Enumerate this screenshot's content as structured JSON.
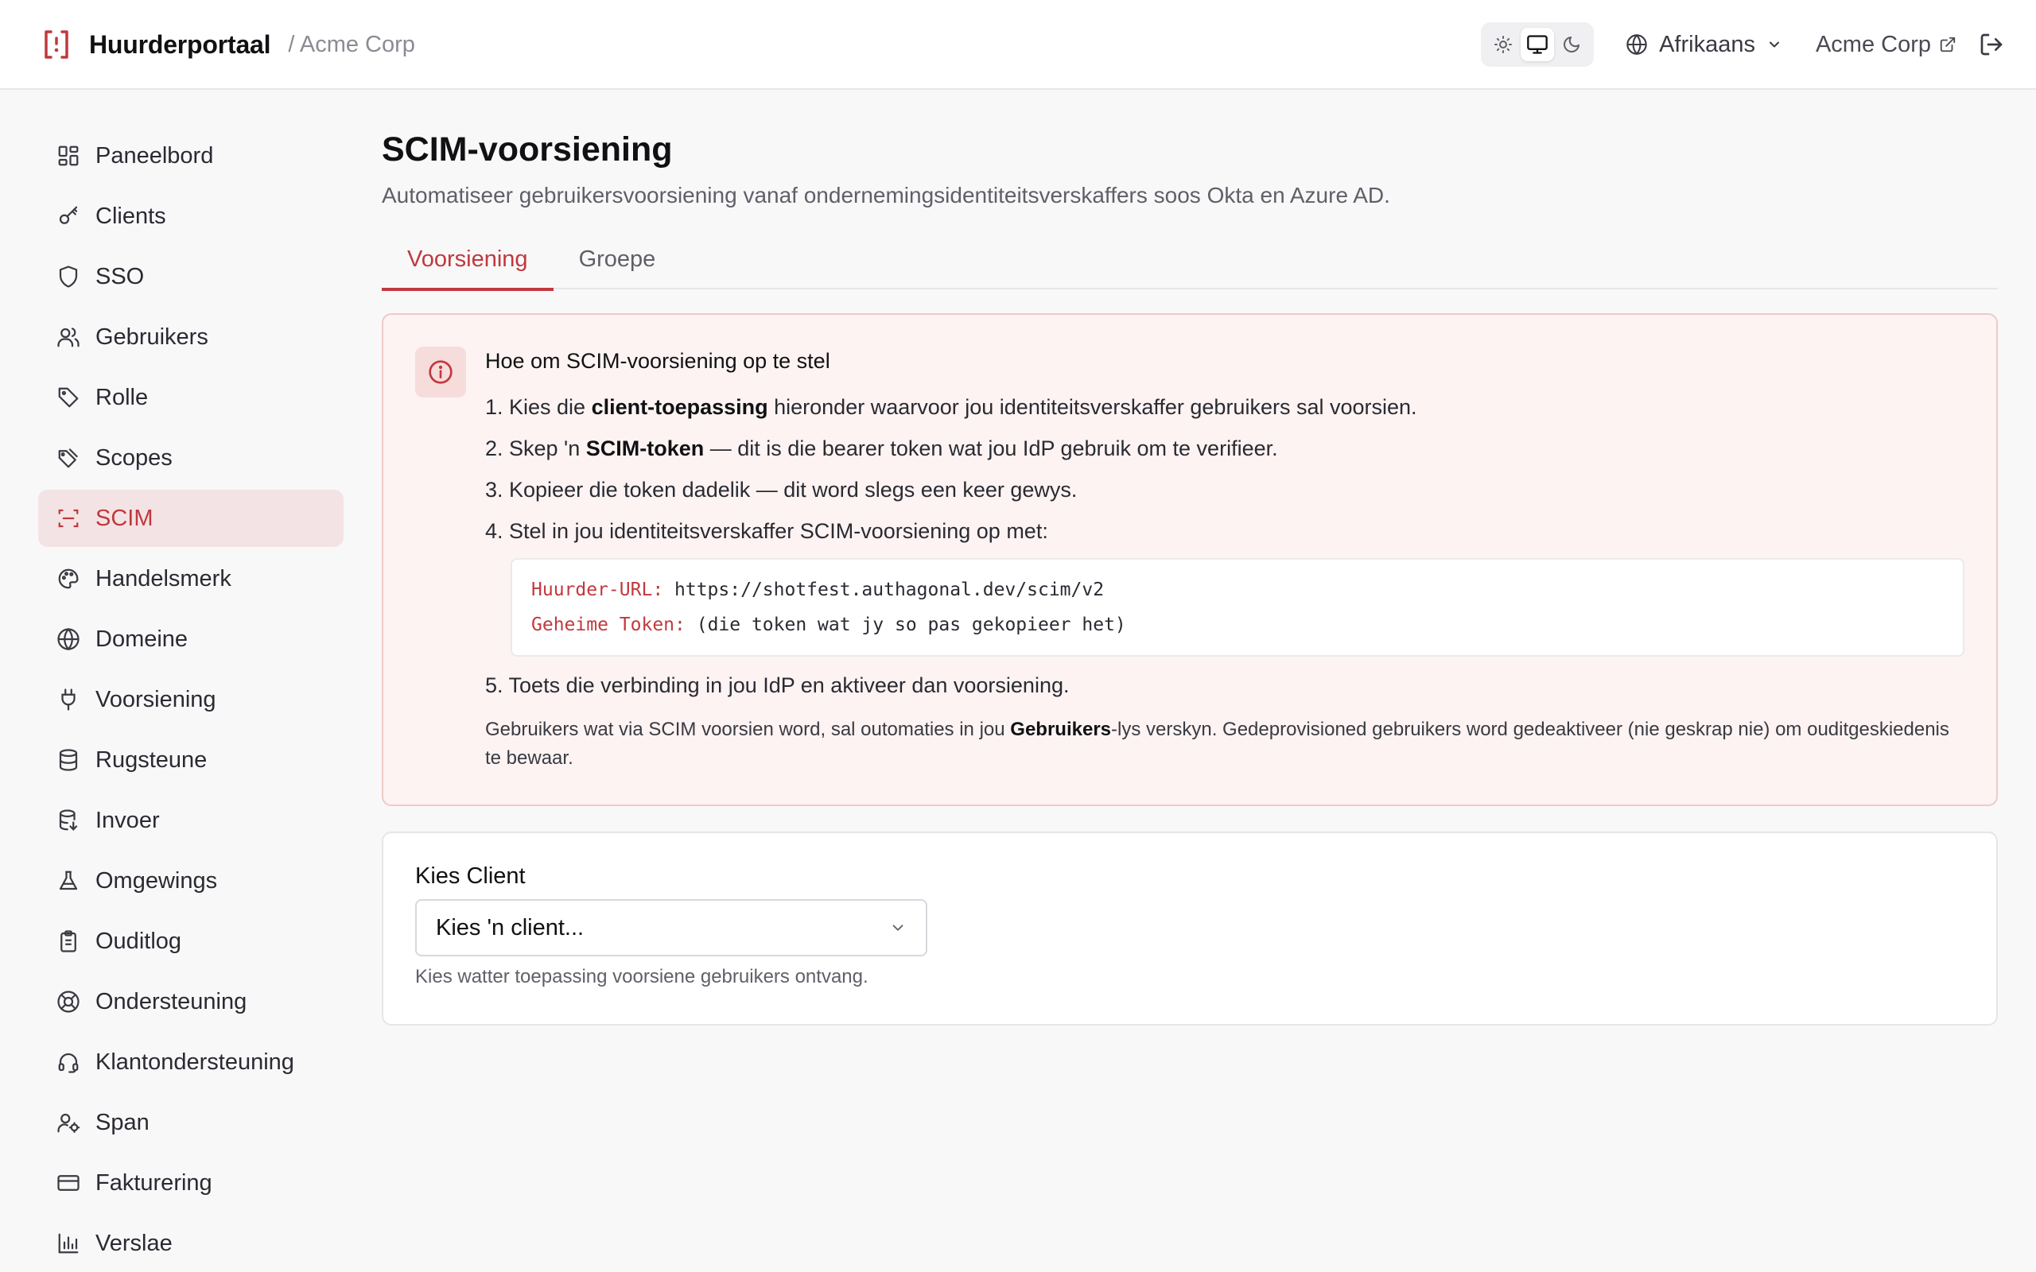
{
  "header": {
    "app_name": "Huurderportaal",
    "tenant_crumb": "/ Acme Corp",
    "language": "Afrikaans",
    "tenant_link": "Acme Corp",
    "theme_active": "system"
  },
  "sidebar": {
    "items": [
      {
        "label": "Paneelbord",
        "icon": "dashboard-icon"
      },
      {
        "label": "Clients",
        "icon": "key-icon"
      },
      {
        "label": "SSO",
        "icon": "shield-icon"
      },
      {
        "label": "Gebruikers",
        "icon": "users-icon"
      },
      {
        "label": "Rolle",
        "icon": "tag-icon"
      },
      {
        "label": "Scopes",
        "icon": "tags-icon"
      },
      {
        "label": "SCIM",
        "icon": "scan-icon",
        "active": true
      },
      {
        "label": "Handelsmerk",
        "icon": "palette-icon"
      },
      {
        "label": "Domeine",
        "icon": "globe-icon"
      },
      {
        "label": "Voorsiening",
        "icon": "plug-icon"
      },
      {
        "label": "Rugsteune",
        "icon": "database-icon"
      },
      {
        "label": "Invoer",
        "icon": "database-import-icon"
      },
      {
        "label": "Omgewings",
        "icon": "flask-icon"
      },
      {
        "label": "Ouditlog",
        "icon": "clipboard-icon"
      },
      {
        "label": "Ondersteuning",
        "icon": "lifebuoy-icon"
      },
      {
        "label": "Klantondersteuning",
        "icon": "headset-icon"
      },
      {
        "label": "Span",
        "icon": "user-cog-icon"
      },
      {
        "label": "Fakturering",
        "icon": "credit-card-icon"
      },
      {
        "label": "Verslae",
        "icon": "bar-chart-icon"
      }
    ]
  },
  "main": {
    "title": "SCIM-voorsiening",
    "subtitle": "Automatiseer gebruikersvoorsiening vanaf ondernemingsidentiteitsverskaffers soos Okta en Azure AD.",
    "tabs": [
      {
        "label": "Voorsiening",
        "active": true
      },
      {
        "label": "Groepe",
        "active": false
      }
    ],
    "info": {
      "title": "Hoe om SCIM-voorsiening op te stel",
      "step1_pre": "1. Kies die ",
      "step1_bold": "client-toepassing",
      "step1_post": " hieronder waarvoor jou identiteitsverskaffer gebruikers sal voorsien.",
      "step2_pre": "2. Skep 'n ",
      "step2_bold": "SCIM-token",
      "step2_post": " — dit is die bearer token wat jou IdP gebruik om te verifieer.",
      "step3": "3. Kopieer die token dadelik — dit word slegs een keer gewys.",
      "step4": "4. Stel in jou identiteitsverskaffer SCIM-voorsiening op met:",
      "code_url_key": "Huurder-URL:",
      "code_url_val": " https://shotfest.authagonal.dev/scim/v2",
      "code_token_key": "Geheime Token:",
      "code_token_val": " (die token wat jy so pas gekopieer het)",
      "step5": "5. Toets die verbinding in jou IdP en aktiveer dan voorsiening.",
      "note_pre": "Gebruikers wat via SCIM voorsien word, sal outomaties in jou ",
      "note_bold": "Gebruikers",
      "note_post": "-lys verskyn. Gedeprovisioned gebruikers word gedeaktiveer (nie geskrap nie) om ouditgeskiedenis te bewaar."
    },
    "client_card": {
      "label": "Kies Client",
      "select_value": "Kies 'n client...",
      "help": "Kies watter toepassing voorsiene gebruikers ontvang."
    }
  },
  "colors": {
    "accent": "#c0393e",
    "active_nav_bg": "#f4e3e4",
    "info_bg": "#fcf3f2",
    "info_border": "#f0c9c6"
  }
}
